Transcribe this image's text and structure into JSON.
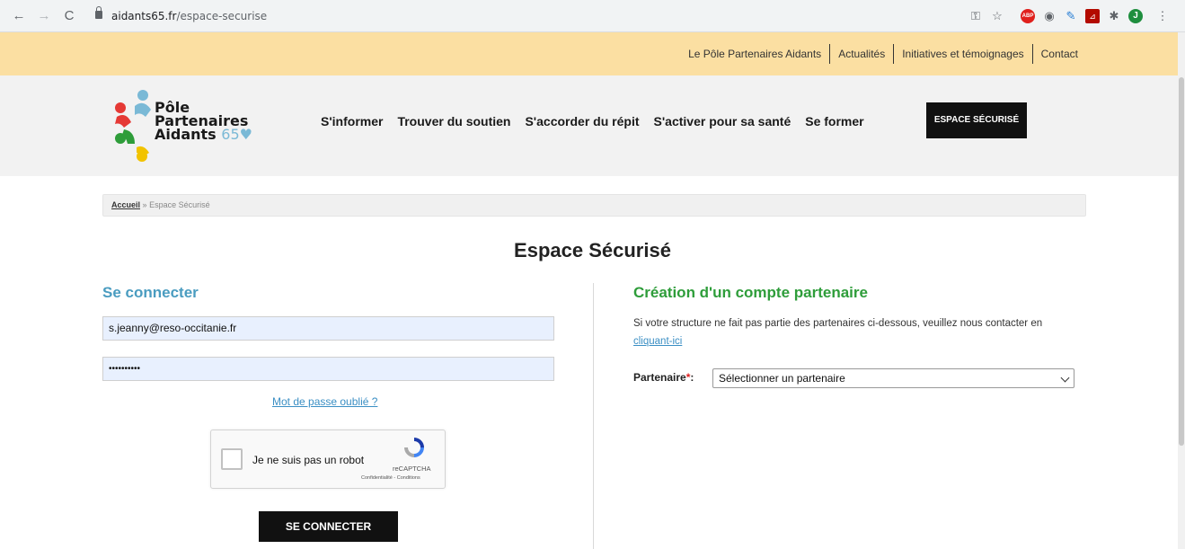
{
  "browser": {
    "url_domain": "aidants65.fr",
    "url_path": "/espace-securise",
    "back_glyph": "←",
    "forward_glyph": "→",
    "reload_glyph": "C",
    "avatar_letter": "J",
    "extensions": [
      "key-icon",
      "star-icon",
      "adblock-icon",
      "circle-icon",
      "pen-icon",
      "pdf-icon",
      "puzzle-icon",
      "profile-avatar",
      "menu-dots-icon"
    ]
  },
  "top_nav": {
    "items": [
      "Le Pôle Partenaires Aidants",
      "Actualités",
      "Initiatives et témoignages",
      "Contact"
    ]
  },
  "logo": {
    "line1": "Pôle",
    "line2": "Partenaires",
    "line3": "Aidants",
    "number": "65"
  },
  "main_nav": {
    "items": [
      "S'informer",
      "Trouver du soutien",
      "S'accorder du répit",
      "S'activer pour sa santé",
      "Se former"
    ],
    "espace_button": "ESPACE SÉCURISÉ"
  },
  "breadcrumb": {
    "home": "Accueil",
    "separator": "»",
    "current": "Espace Sécurisé"
  },
  "page_title": "Espace Sécurisé",
  "login": {
    "title": "Se connecter",
    "email_value": "s.jeanny@reso-occitanie.fr",
    "password_value": "••••••••••",
    "forgot_link": "Mot de passe oublié ?",
    "captcha_label": "Je ne suis pas un robot",
    "captcha_brand": "reCAPTCHA",
    "captcha_terms": "Confidentialité - Conditions",
    "submit_label": "SE CONNECTER"
  },
  "partner": {
    "title": "Création d'un compte partenaire",
    "info_text": "Si votre structure ne fait pas partie des partenaires ci-dessous, veuillez nous contacter en",
    "info_link": "cliquant-ici",
    "label": "Partenaire",
    "required_mark": "*",
    "colon": ":",
    "select_value": "Sélectionner un partenaire"
  },
  "colors": {
    "top_bar": "#fbdfa2",
    "login_title": "#4a9cc0",
    "partner_title": "#2e9d3a",
    "dark_button": "#111111"
  }
}
